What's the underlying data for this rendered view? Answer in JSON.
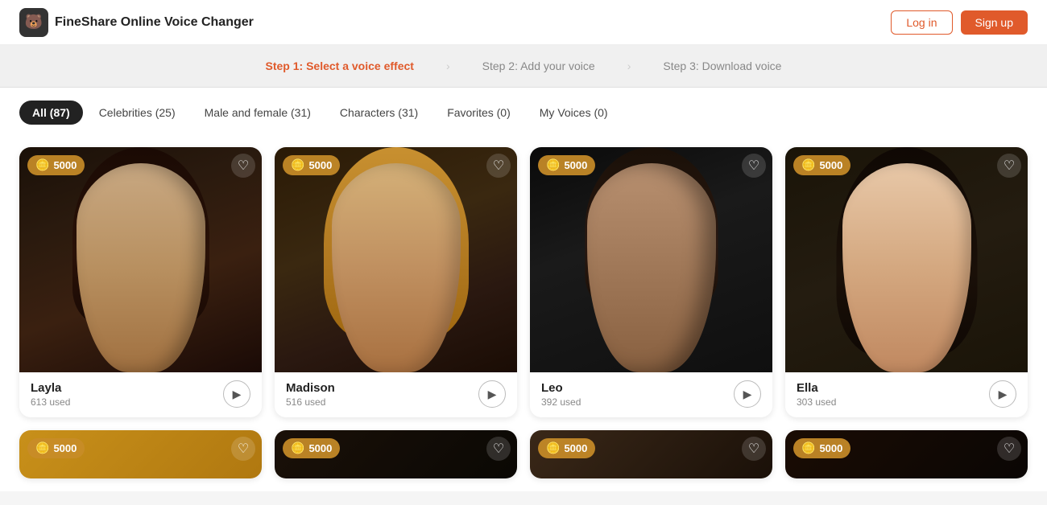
{
  "app": {
    "logo_emoji": "🐻",
    "title": "FineShare Online Voice Changer"
  },
  "header": {
    "login_label": "Log in",
    "signup_label": "Sign up"
  },
  "steps": [
    {
      "id": "step1",
      "label": "Step 1: Select a voice effect",
      "active": true
    },
    {
      "id": "step2",
      "label": "Step 2: Add your voice",
      "active": false
    },
    {
      "id": "step3",
      "label": "Step 3: Download voice",
      "active": false
    }
  ],
  "filter_tabs": [
    {
      "id": "all",
      "label": "All (87)",
      "active": true
    },
    {
      "id": "celebrities",
      "label": "Celebrities (25)",
      "active": false
    },
    {
      "id": "male_female",
      "label": "Male and female (31)",
      "active": false
    },
    {
      "id": "characters",
      "label": "Characters (31)",
      "active": false
    },
    {
      "id": "favorites",
      "label": "Favorites (0)",
      "active": false
    },
    {
      "id": "my_voices",
      "label": "My Voices (0)",
      "active": false
    }
  ],
  "voice_cards": [
    {
      "id": "layla",
      "name": "Layla",
      "used": "613 used",
      "coins": "5000",
      "img_class": "card-img-layla"
    },
    {
      "id": "madison",
      "name": "Madison",
      "used": "516 used",
      "coins": "5000",
      "img_class": "card-img-madison"
    },
    {
      "id": "leo",
      "name": "Leo",
      "used": "392 used",
      "coins": "5000",
      "img_class": "card-img-leo"
    },
    {
      "id": "ella",
      "name": "Ella",
      "used": "303 used",
      "coins": "5000",
      "img_class": "card-img-ella"
    }
  ],
  "partial_cards": [
    {
      "id": "p1",
      "coins": "5000",
      "img_class": "partial-img-1"
    },
    {
      "id": "p2",
      "coins": "5000",
      "img_class": "partial-img-2"
    },
    {
      "id": "p3",
      "coins": "5000",
      "img_class": "partial-img-3"
    },
    {
      "id": "p4",
      "coins": "5000",
      "img_class": "partial-img-4"
    }
  ]
}
